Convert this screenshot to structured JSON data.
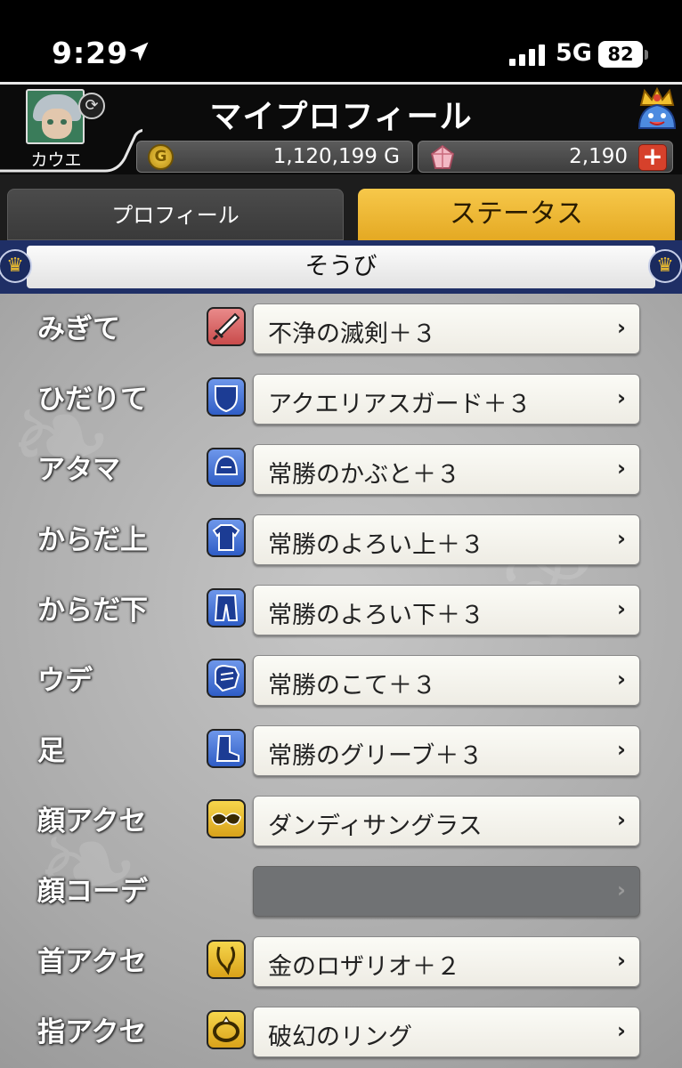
{
  "status_bar": {
    "time": "9:29",
    "network": "5G",
    "battery": "82"
  },
  "header": {
    "title": "マイプロフィール",
    "character_name": "カウエ",
    "gold": "1,120,199 G",
    "gems": "2,190",
    "gold_coin_symbol": "G",
    "plus_symbol": "+"
  },
  "tabs": {
    "profile": "プロフィール",
    "status": "ステータス",
    "active": "status"
  },
  "section": {
    "title": "そうび"
  },
  "equipment": [
    {
      "slot": "みぎて",
      "item": "不浄の滅剣＋３",
      "icon": "sword-icon",
      "icon_color": "red"
    },
    {
      "slot": "ひだりて",
      "item": "アクエリアスガード＋３",
      "icon": "shield-icon",
      "icon_color": "blue"
    },
    {
      "slot": "アタマ",
      "item": "常勝のかぶと＋３",
      "icon": "helmet-icon",
      "icon_color": "blue"
    },
    {
      "slot": "からだ上",
      "item": "常勝のよろい上＋３",
      "icon": "armor-top-icon",
      "icon_color": "blue"
    },
    {
      "slot": "からだ下",
      "item": "常勝のよろい下＋３",
      "icon": "armor-bottom-icon",
      "icon_color": "blue"
    },
    {
      "slot": "ウデ",
      "item": "常勝のこて＋３",
      "icon": "gauntlet-icon",
      "icon_color": "blue"
    },
    {
      "slot": "足",
      "item": "常勝のグリーブ＋３",
      "icon": "boots-icon",
      "icon_color": "blue"
    },
    {
      "slot": "顔アクセ",
      "item": "ダンディサングラス",
      "icon": "face-accessory-icon",
      "icon_color": "gold"
    },
    {
      "slot": "顔コーデ",
      "item": "",
      "icon": "",
      "icon_color": ""
    },
    {
      "slot": "首アクセ",
      "item": "金のロザリオ＋２",
      "icon": "necklace-icon",
      "icon_color": "gold"
    },
    {
      "slot": "指アクセ",
      "item": "破幻のリング",
      "icon": "ring-icon",
      "icon_color": "gold"
    }
  ],
  "colors": {
    "tab_active": "#f2bd3c",
    "section_bg": "#1f2f66",
    "plus_button": "#d6412b"
  }
}
